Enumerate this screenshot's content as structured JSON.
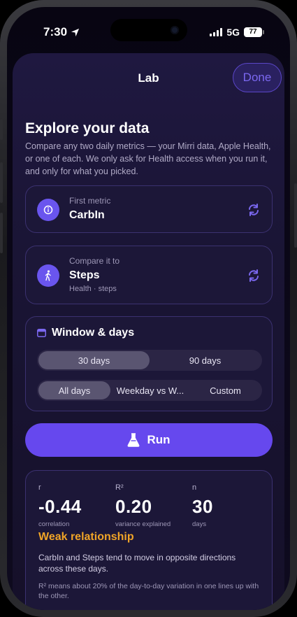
{
  "status_bar": {
    "time": "7:30",
    "network": "5G",
    "battery": "77"
  },
  "nav": {
    "title": "Lab",
    "done_label": "Done"
  },
  "intro": {
    "heading": "Explore your data",
    "text": "Compare any two daily metrics — your Mirri data, Apple Health, or one of each. We only ask for Health access when you run it, and only for what you picked."
  },
  "first_metric": {
    "label": "First metric",
    "value": "CarbIn",
    "icon": "info-icon"
  },
  "second_metric": {
    "label": "Compare it to",
    "value": "Steps",
    "sub": "Health · steps",
    "icon": "walking-icon"
  },
  "window": {
    "title": "Window & days",
    "ranges": [
      {
        "label": "30 days",
        "selected": true
      },
      {
        "label": "90 days",
        "selected": false
      }
    ],
    "day_filters": [
      {
        "label": "All days",
        "selected": true
      },
      {
        "label": "Weekday vs W...",
        "selected": false
      },
      {
        "label": "Custom",
        "selected": false
      }
    ]
  },
  "run": {
    "label": "Run"
  },
  "results": {
    "r": {
      "label": "r",
      "value": "-0.44",
      "caption": "correlation"
    },
    "r2": {
      "label": "R²",
      "value": "0.20",
      "caption": "variance explained"
    },
    "n": {
      "label": "n",
      "value": "30",
      "caption": "days"
    },
    "verdict": "Weak relationship",
    "text": "CarbIn and Steps tend to move in opposite directions across these days.",
    "note": "R² means about 20% of the day-to-day variation in one lines up with the other."
  },
  "colors": {
    "accent": "#6648ee",
    "verdict": "#f0a427",
    "background": "#151029"
  }
}
